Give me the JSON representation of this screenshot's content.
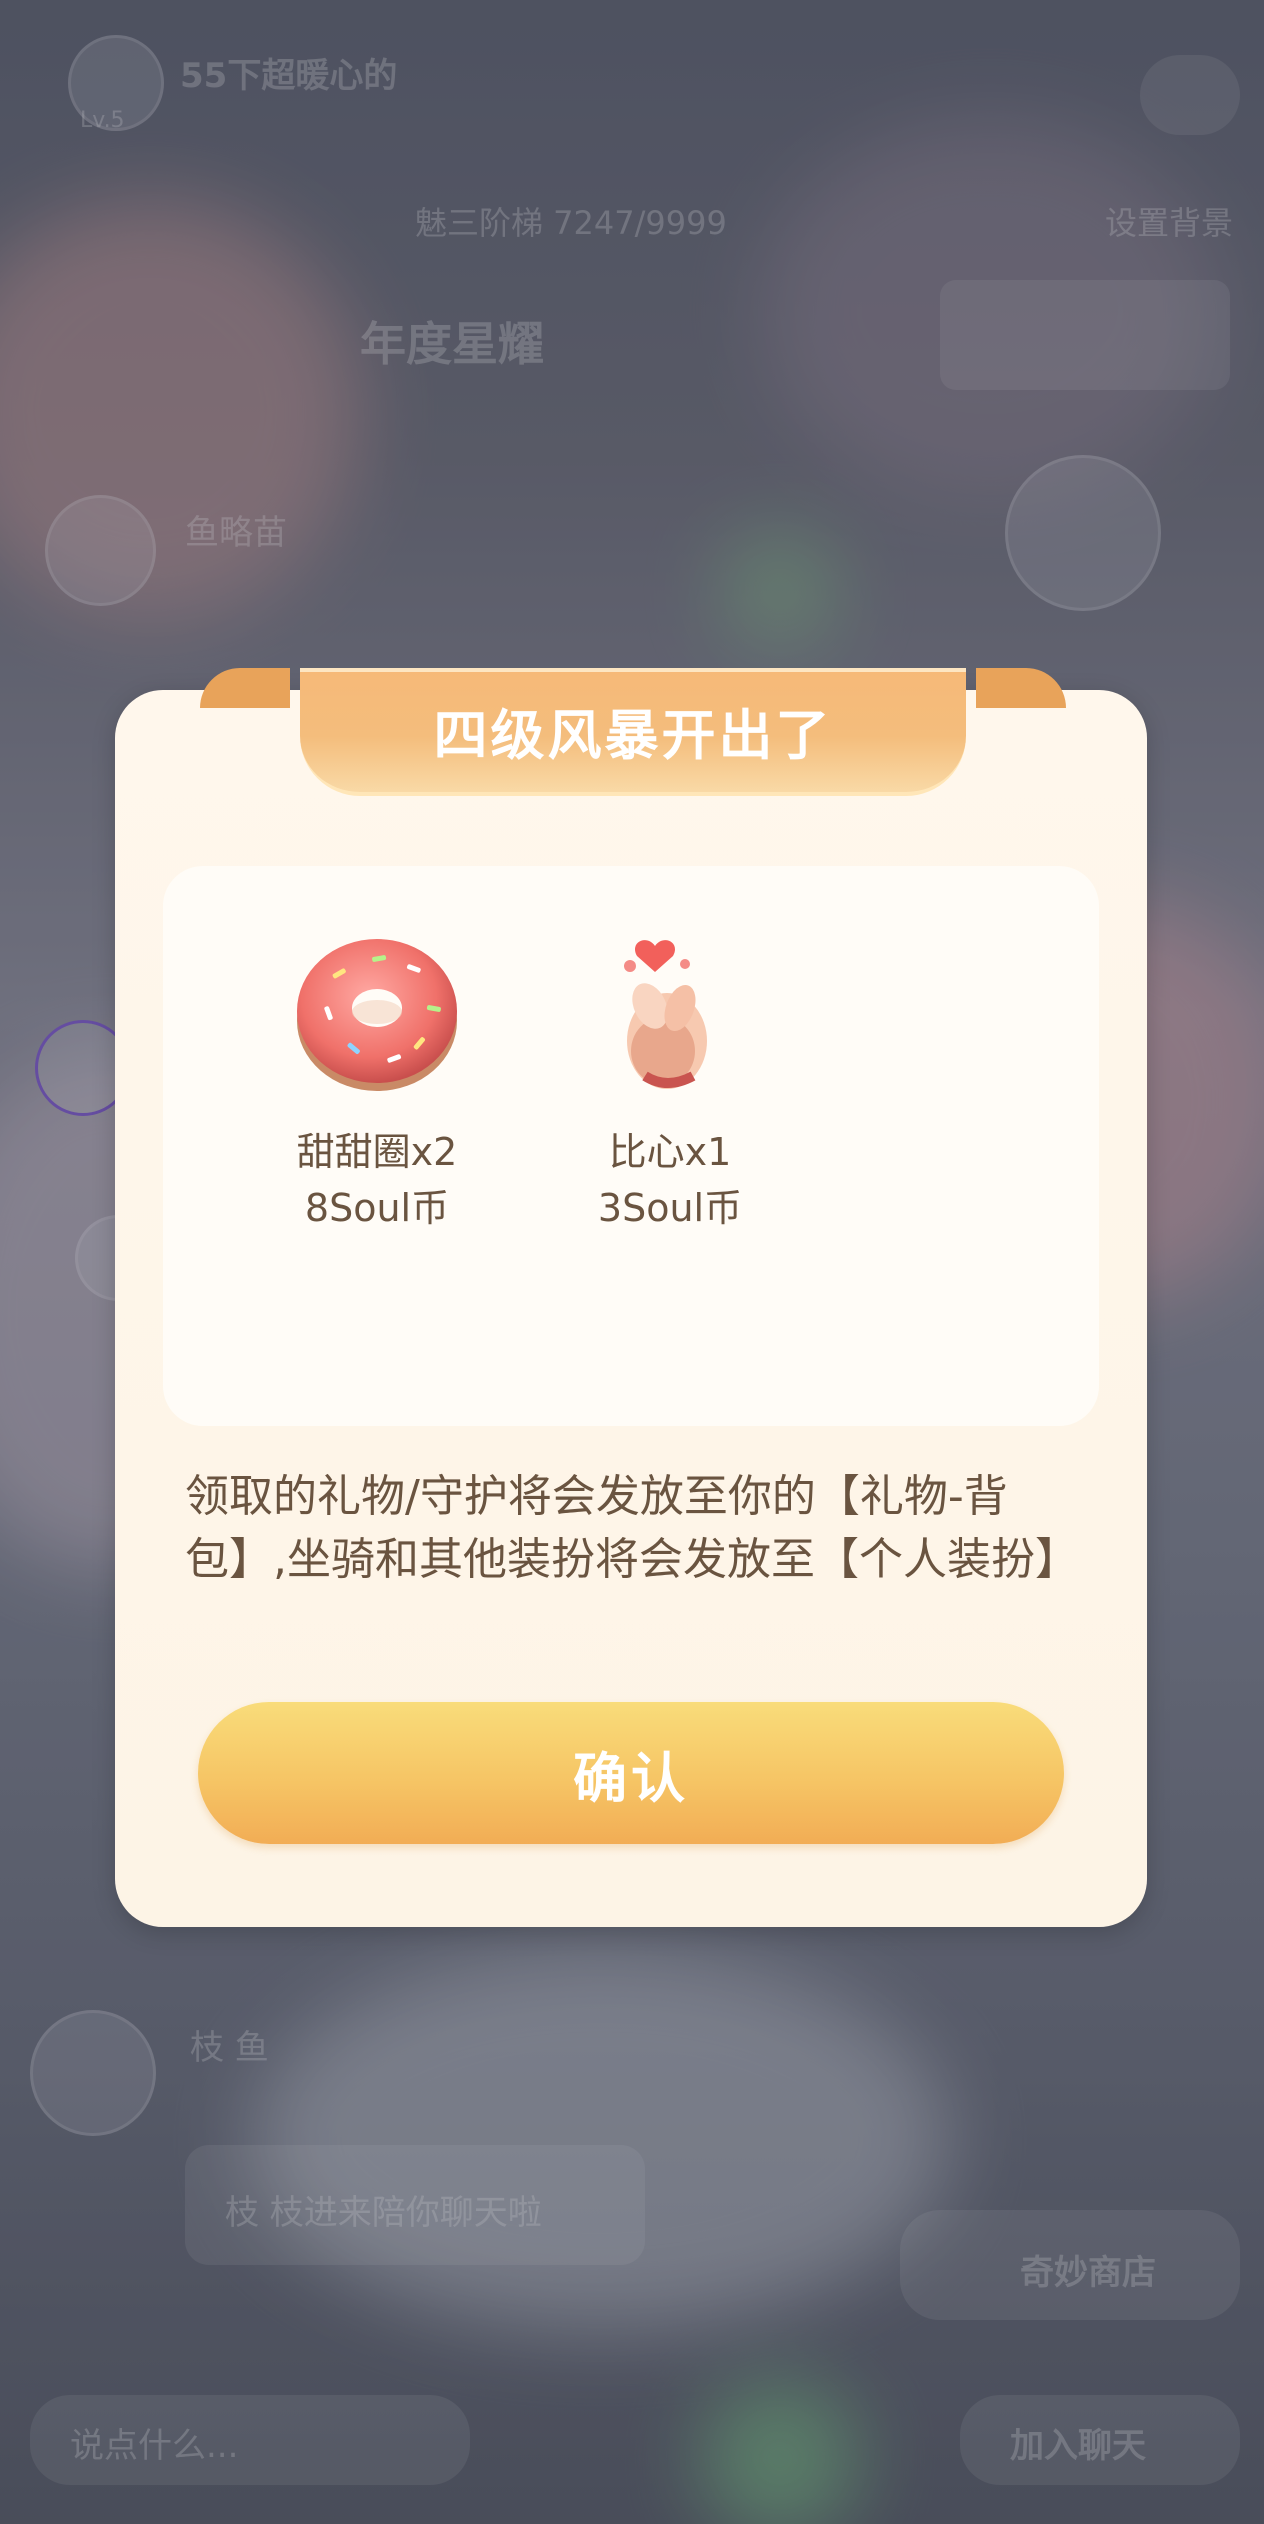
{
  "background": {
    "room_name": "55下超暖心的",
    "level_badge": "Lv.5",
    "ladder_text": "魅三阶梯 7247/9999",
    "set_background": "设置背景",
    "annual_star": "年度星耀",
    "host_name": "鱼略苗",
    "invite_text": "枝 枝进来陪你聊天啦",
    "user_name": "枝 鱼",
    "chat_placeholder": "说点什么...",
    "join_chat": "加入聊天",
    "shop_label": "奇妙商店"
  },
  "dialog": {
    "title": "四级风暴开出了",
    "rewards": [
      {
        "name": "甜甜圈x2",
        "price": "8Soul币",
        "icon": "donut-icon"
      },
      {
        "name": "比心x1",
        "price": "3Soul币",
        "icon": "finger-heart-icon"
      }
    ],
    "notice": "领取的礼物/守护将会发放至你的【礼物-背包】,坐骑和其他装扮将会发放至【个人装扮】",
    "confirm_label": "确认"
  },
  "colors": {
    "banner": "#f4bd7c",
    "button": "#f6c565",
    "text": "#6a5440",
    "dialog_bg": "#fff7ec"
  }
}
